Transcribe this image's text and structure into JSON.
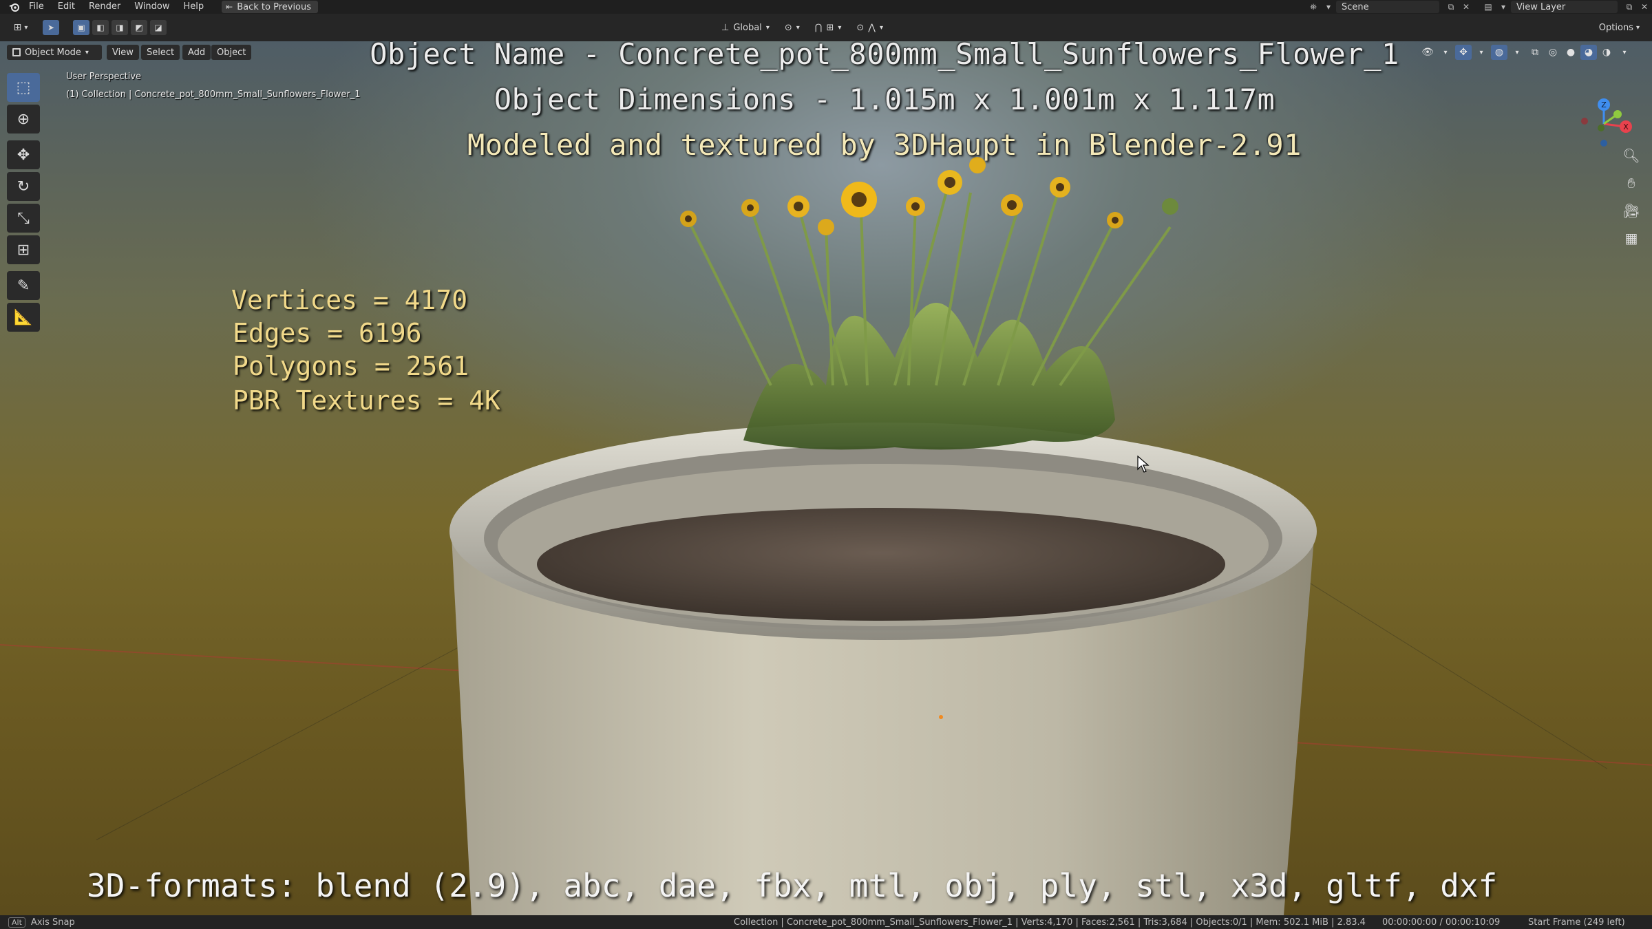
{
  "topbar": {
    "menus": [
      "File",
      "Edit",
      "Render",
      "Window",
      "Help"
    ],
    "back_button": "Back to Previous",
    "scene_label": "Scene",
    "view_layer_label": "View Layer"
  },
  "header": {
    "transform_orientation": "Global",
    "options_label": "Options"
  },
  "viewport": {
    "mode": "Object Mode",
    "menus": {
      "view": "View",
      "select": "Select",
      "add": "Add",
      "object": "Object"
    },
    "perspective": "User Perspective",
    "collection_info": "(1) Collection | Concrete_pot_800mm_Small_Sunflowers_Flower_1"
  },
  "overlay": {
    "title1": "Object Name - Concrete_pot_800mm_Small_Sunflowers_Flower_1",
    "title2": "Object Dimensions -  1.015m x 1.001m x 1.117m",
    "title3": "Modeled and textured by 3DHaupt in Blender-2.91",
    "stats": {
      "vertices": "Vertices = 4170",
      "edges": "Edges = 6196",
      "polygons": "Polygons = 2561",
      "textures": "PBR Textures = 4K"
    },
    "formats": "3D-formats: blend (2.9), abc, dae, fbx, mtl, obj, ply, stl, x3d, gltf, dxf"
  },
  "statusbar": {
    "key": "Alt",
    "hint": "Axis Snap",
    "stats": "Collection | Concrete_pot_800mm_Small_Sunflowers_Flower_1 | Verts:4,170 | Faces:2,561 | Tris:3,684 | Objects:0/1 | Mem: 502.1 MiB | 2.83.4",
    "time": "00:00:00:00 / 00:00:10:09",
    "frame": "Start Frame (249 left)"
  },
  "gizmo_axes": {
    "x": "X",
    "y": "Y",
    "z": "Z"
  },
  "colors": {
    "axis_x": "#e8424d",
    "axis_y": "#8fca3f",
    "axis_z": "#3f8ef0",
    "stat_text": "#f1d98a",
    "active_tool": "#4a6a9a"
  },
  "icons": {
    "tools": [
      "select-box-icon",
      "cursor-icon",
      "move-icon",
      "rotate-icon",
      "scale-icon",
      "transform-icon",
      "annotate-icon",
      "measure-icon"
    ],
    "navigation": [
      "zoom-icon",
      "pan-hand-icon",
      "camera-icon",
      "ortho-grid-icon"
    ]
  }
}
